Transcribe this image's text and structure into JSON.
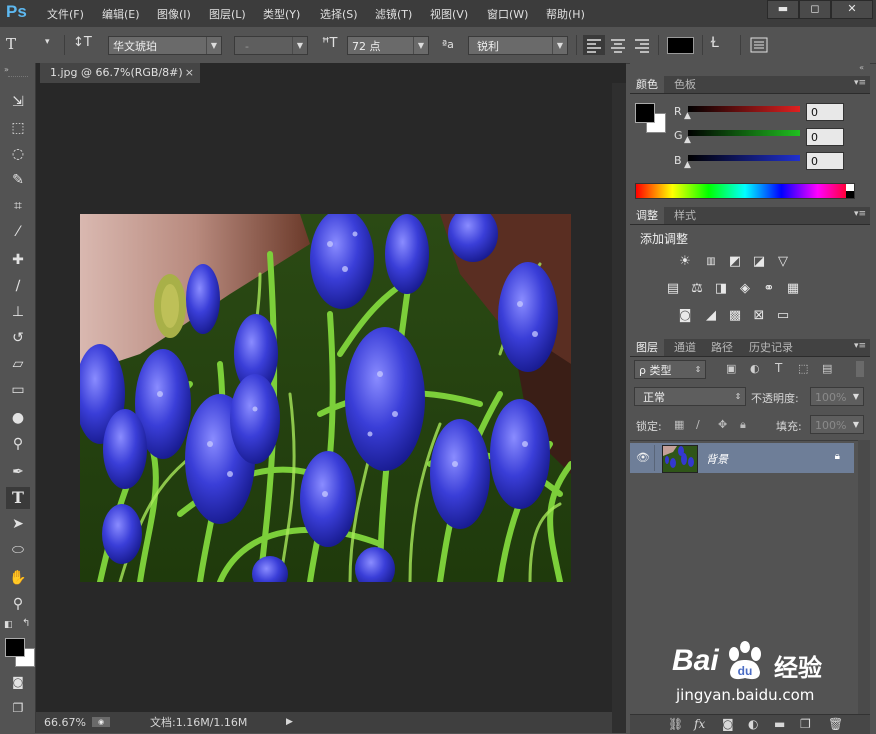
{
  "app": {
    "logo": "Ps"
  },
  "menu": [
    "文件(F)",
    "编辑(E)",
    "图像(I)",
    "图层(L)",
    "类型(Y)",
    "选择(S)",
    "滤镜(T)",
    "视图(V)",
    "窗口(W)",
    "帮助(H)"
  ],
  "window_buttons": {
    "minimize": "▬",
    "maximize": "◻",
    "close": "✕"
  },
  "options": {
    "tool_glyph": "T",
    "font_family": "华文琥珀",
    "font_style": "-",
    "font_size": "72 点",
    "aa_glyph": "ªa",
    "antialias": "锐利",
    "text_color": "#000000"
  },
  "document": {
    "tab_title": "1.jpg @ 66.7%(RGB/8#)",
    "tab_close": "×",
    "zoom": "66.67%",
    "doc_info": "文档:1.16M/1.16M"
  },
  "colors": {
    "foreground": "#000000",
    "background": "#ffffff"
  },
  "color_panel": {
    "tabs": [
      "颜色",
      "色板"
    ],
    "channels": [
      {
        "label": "R",
        "value": "0",
        "color": "#e02020"
      },
      {
        "label": "G",
        "value": "0",
        "color": "#20c020"
      },
      {
        "label": "B",
        "value": "0",
        "color": "#2030d0"
      }
    ]
  },
  "adjust_panel": {
    "tabs": [
      "调整",
      "样式"
    ],
    "title": "添加调整"
  },
  "layers_panel": {
    "tabs": [
      "图层",
      "通道",
      "路径",
      "历史记录"
    ],
    "filter_kind": "ρ 类型",
    "blend_mode": "正常",
    "opacity_label": "不透明度:",
    "opacity_value": "100%",
    "lock_label": "锁定:",
    "fill_label": "填充:",
    "fill_value": "100%",
    "layers": [
      {
        "name": "背景",
        "visible": true,
        "locked": true
      }
    ]
  },
  "watermark": {
    "text1": "Bai",
    "text2": "du",
    "text3": "经验",
    "url": "jingyan.baidu.com"
  }
}
